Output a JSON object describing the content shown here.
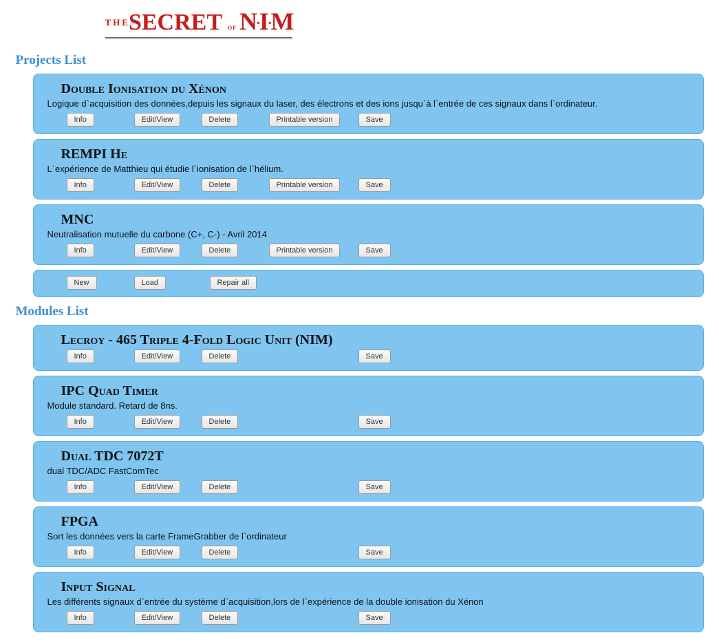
{
  "logo": {
    "the": "THE",
    "secret": "SECRET",
    "of": "of",
    "nim1": "N",
    "nim2": "I",
    "nim3": "M"
  },
  "sections": {
    "projects_title": "Projects List",
    "modules_title": "Modules List"
  },
  "buttons": {
    "info": "Info",
    "edit": "Edit/View",
    "delete": "Delete",
    "print": "Printable version",
    "save": "Save",
    "new": "New",
    "load": "Load",
    "repair": "Repair all"
  },
  "projects": [
    {
      "title": "Double Ionisation du Xénon",
      "desc": "Logique d`acquisition des données,depuis les signaux du laser, des électrons et des ions jusqu`à l`entrée de ces signaux dans l`ordinateur."
    },
    {
      "title": "REMPI He",
      "desc": "L`expérience de Matthieu qui étudie l`ionisation de l`hélium."
    },
    {
      "title": "MNC",
      "desc": "Neutralisation mutuelle du carbone (C+, C-) - Avril 2014"
    }
  ],
  "modules": [
    {
      "title": "Lecroy - 465 Triple 4-Fold Logic Unit (NIM)",
      "desc": ""
    },
    {
      "title": "IPC Quad Timer",
      "desc": "Module standard. Retard de 8ns."
    },
    {
      "title": "Dual TDC 7072T",
      "desc": "dual TDC/ADC FastComTec"
    },
    {
      "title": "FPGA",
      "desc": "Sort les données vers la carte FrameGrabber de l`ordinateur"
    },
    {
      "title": "Input Signal",
      "desc": "Les différents signaux d`entrée du système d`acquisition,lors de l`expérience de la double ionisation du Xénon"
    }
  ]
}
